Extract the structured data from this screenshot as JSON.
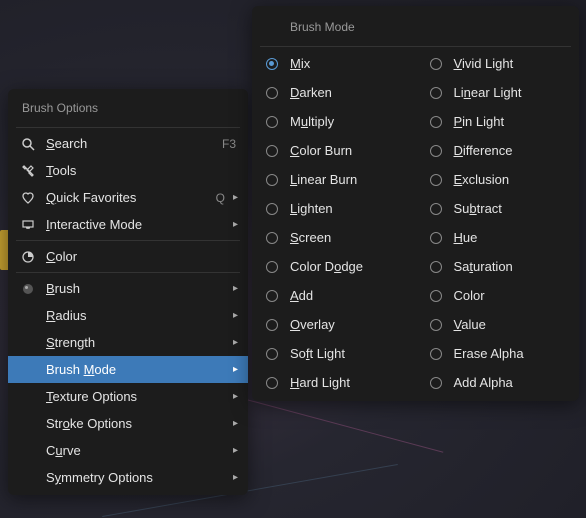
{
  "leftMenu": {
    "title": "Brush Options",
    "search": {
      "label": "Search",
      "accel": 0,
      "shortcut": "F3"
    },
    "tools": {
      "label": "Tools",
      "accel": 0
    },
    "quickFavorites": {
      "label": "Quick Favorites",
      "accel": 0,
      "shortcut": "Q"
    },
    "interactiveMode": {
      "label": "Interactive Mode",
      "accel": 0
    },
    "color": {
      "label": "Color",
      "accel": 0
    },
    "brush": {
      "label": "Brush",
      "accel": 0
    },
    "radius": {
      "label": "Radius",
      "accel": 0
    },
    "strength": {
      "label": "Strength",
      "accel": 0
    },
    "brushMode": {
      "label": "Brush Mode",
      "accel": 6
    },
    "textureOptions": {
      "label": "Texture Options",
      "accel": 0
    },
    "strokeOptions": {
      "label": "Stroke Options",
      "accel": 3
    },
    "curve": {
      "label": "Curve",
      "accel": 1
    },
    "symmetryOptions": {
      "label": "Symmetry Options",
      "accel": 1
    }
  },
  "rightMenu": {
    "title": "Brush Mode",
    "selected": "Mix",
    "col1": [
      {
        "label": "Mix",
        "accel": 0
      },
      {
        "label": "Darken",
        "accel": 0
      },
      {
        "label": "Multiply",
        "accel": 1
      },
      {
        "label": "Color Burn",
        "accel": 0
      },
      {
        "label": "Linear Burn",
        "accel": 0
      },
      {
        "label": "Lighten",
        "accel": 0
      },
      {
        "label": "Screen",
        "accel": 0
      },
      {
        "label": "Color Dodge",
        "accel": 7
      },
      {
        "label": "Add",
        "accel": 0
      },
      {
        "label": "Overlay",
        "accel": 0
      },
      {
        "label": "Soft Light",
        "accel": 2
      },
      {
        "label": "Hard Light",
        "accel": 0
      }
    ],
    "col2": [
      {
        "label": "Vivid Light",
        "accel": 0
      },
      {
        "label": "Linear Light",
        "accel": 2
      },
      {
        "label": "Pin Light",
        "accel": 0
      },
      {
        "label": "Difference",
        "accel": 0
      },
      {
        "label": "Exclusion",
        "accel": 0
      },
      {
        "label": "Subtract",
        "accel": 2
      },
      {
        "label": "Hue",
        "accel": 0
      },
      {
        "label": "Saturation",
        "accel": 2
      },
      {
        "label": "Color",
        "accel": -1
      },
      {
        "label": "Value",
        "accel": 0
      },
      {
        "label": "Erase Alpha",
        "accel": -1
      },
      {
        "label": "Add Alpha",
        "accel": -1
      }
    ]
  }
}
